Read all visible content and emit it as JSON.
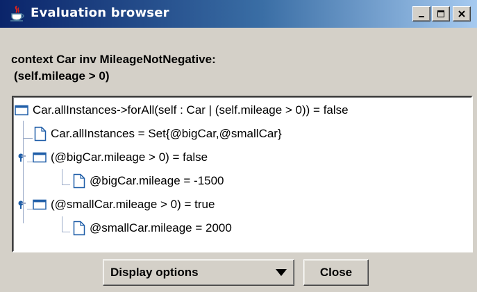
{
  "window": {
    "title": "Evaluation browser",
    "icon": "java-cup-icon",
    "controls": {
      "minimize": "minimize-icon",
      "maximize": "maximize-icon",
      "close": "close-icon"
    }
  },
  "header": {
    "line1": "context Car inv MileageNotNegative:",
    "line2": "(self.mileage > 0)"
  },
  "tree": [
    {
      "label": "Car.allInstances->forAll(self : Car | (self.mileage > 0)) = false",
      "type": "folder",
      "expanded": true
    },
    {
      "label": "Car.allInstances = Set{@bigCar,@smallCar}",
      "type": "document"
    },
    {
      "label": "(@bigCar.mileage > 0) = false",
      "type": "folder",
      "expanded": true
    },
    {
      "label": "@bigCar.mileage = -1500",
      "type": "document"
    },
    {
      "label": "(@smallCar.mileage > 0) = true",
      "type": "folder",
      "expanded": true
    },
    {
      "label": "@smallCar.mileage = 2000",
      "type": "document"
    }
  ],
  "buttons": {
    "display_options": "Display options",
    "close": "Close"
  },
  "colors": {
    "titlebar_start": "#0a246a",
    "titlebar_end": "#a6caf0",
    "icon_blue": "#1f5ea8",
    "window_bg": "#d4d0c8"
  }
}
